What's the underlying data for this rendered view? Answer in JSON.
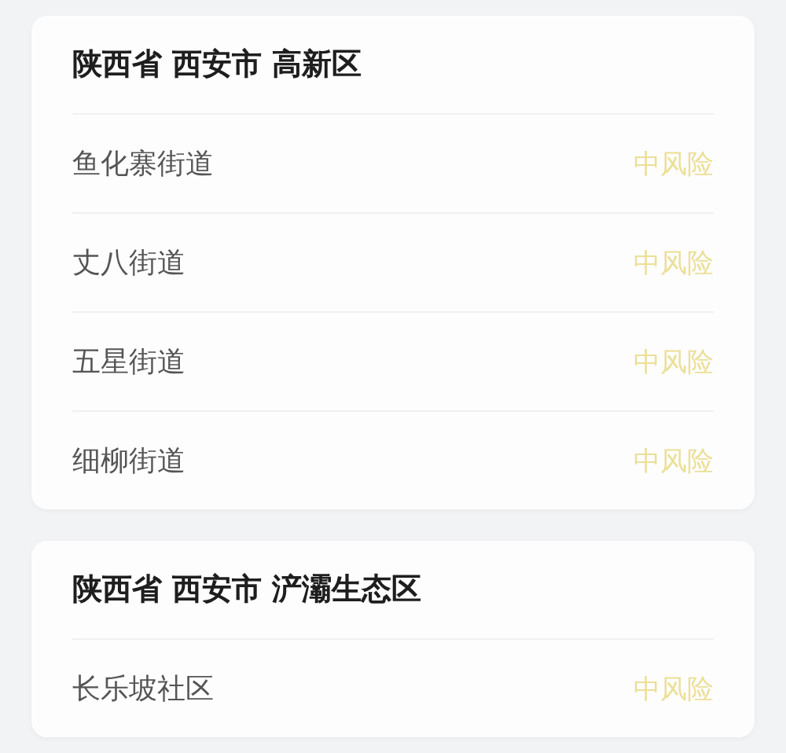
{
  "areas": [
    {
      "title": "陕西省 西安市 高新区",
      "rows": [
        {
          "name": "鱼化寨街道",
          "risk": "中风险"
        },
        {
          "name": "丈八街道",
          "risk": "中风险"
        },
        {
          "name": "五星街道",
          "risk": "中风险"
        },
        {
          "name": "细柳街道",
          "risk": "中风险"
        }
      ]
    },
    {
      "title": "陕西省 西安市 浐灞生态区",
      "rows": [
        {
          "name": "长乐坡社区",
          "risk": "中风险"
        }
      ]
    }
  ]
}
